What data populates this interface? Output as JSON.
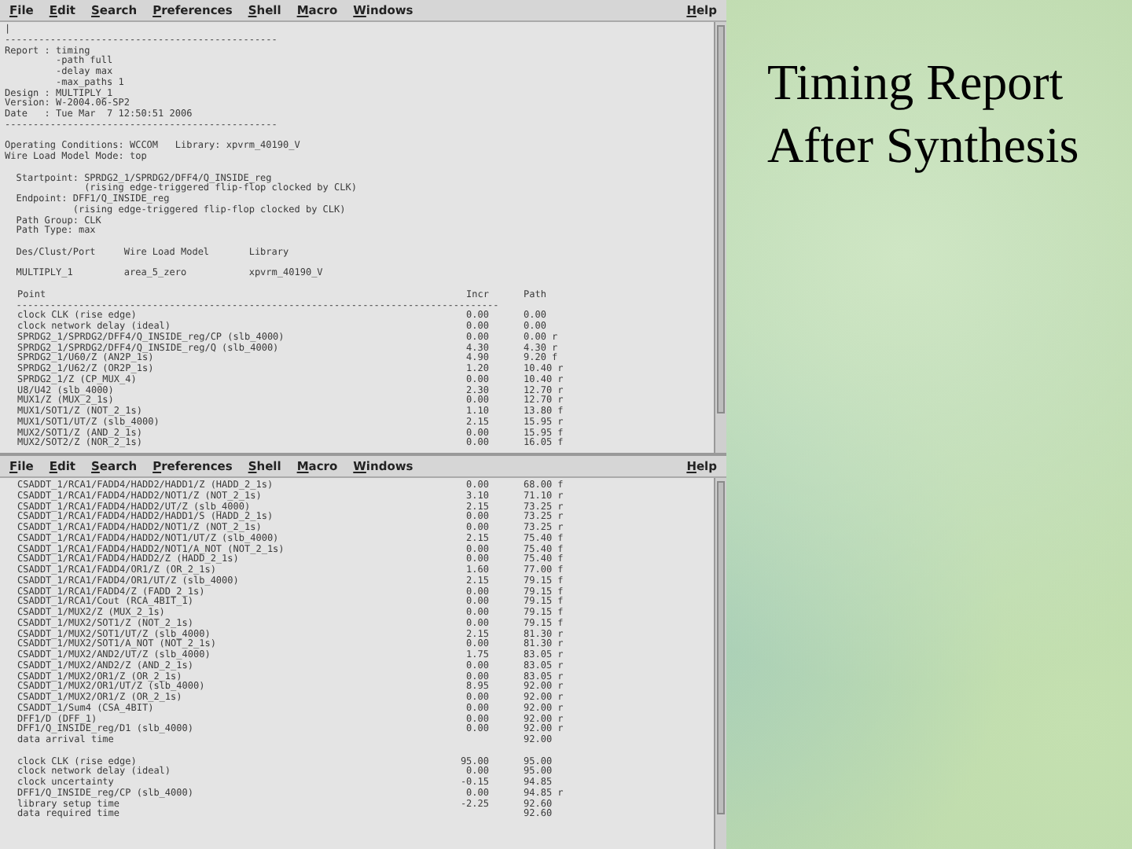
{
  "slide": {
    "title": "Timing Report After Synthesis"
  },
  "windows": [
    {
      "menu": [
        "File",
        "Edit",
        "Search",
        "Preferences",
        "Shell",
        "Macro",
        "Windows"
      ],
      "help": "Help",
      "lines": [
        {
          "kind": "text",
          "text": "|"
        },
        {
          "kind": "text",
          "text": "------------------------------------------------"
        },
        {
          "kind": "text",
          "text": "Report : timing"
        },
        {
          "kind": "text",
          "text": "         -path full"
        },
        {
          "kind": "text",
          "text": "         -delay max"
        },
        {
          "kind": "text",
          "text": "         -max_paths 1"
        },
        {
          "kind": "text",
          "text": "Design : MULTIPLY_1"
        },
        {
          "kind": "text",
          "text": "Version: W-2004.06-SP2"
        },
        {
          "kind": "text",
          "text": "Date   : Tue Mar  7 12:50:51 2006"
        },
        {
          "kind": "text",
          "text": "------------------------------------------------"
        },
        {
          "kind": "blank"
        },
        {
          "kind": "text",
          "text": "Operating Conditions: WCCOM   Library: xpvrm_40190_V"
        },
        {
          "kind": "text",
          "text": "Wire Load Model Mode: top"
        },
        {
          "kind": "blank"
        },
        {
          "kind": "text",
          "text": "  Startpoint: SPRDG2_1/SPRDG2/DFF4/Q_INSIDE_reg"
        },
        {
          "kind": "text",
          "text": "              (rising edge-triggered flip-flop clocked by CLK)"
        },
        {
          "kind": "text",
          "text": "  Endpoint: DFF1/Q_INSIDE_reg"
        },
        {
          "kind": "text",
          "text": "            (rising edge-triggered flip-flop clocked by CLK)"
        },
        {
          "kind": "text",
          "text": "  Path Group: CLK"
        },
        {
          "kind": "text",
          "text": "  Path Type: max"
        },
        {
          "kind": "blank"
        },
        {
          "kind": "text",
          "text": "  Des/Clust/Port     Wire Load Model       Library"
        },
        {
          "kind": "blank"
        },
        {
          "kind": "text",
          "text": "  MULTIPLY_1         area_5_zero           xpvrm_40190_V"
        },
        {
          "kind": "blank"
        },
        {
          "kind": "row",
          "point": "Point",
          "incr": "Incr",
          "path": "Path"
        },
        {
          "kind": "text",
          "text": "  -------------------------------------------------------------------------------------"
        },
        {
          "kind": "row",
          "point": "clock CLK (rise edge)",
          "incr": "0.00",
          "path": "0.00"
        },
        {
          "kind": "row",
          "point": "clock network delay (ideal)",
          "incr": "0.00",
          "path": "0.00"
        },
        {
          "kind": "row",
          "point": "SPRDG2_1/SPRDG2/DFF4/Q_INSIDE_reg/CP (slb_4000)",
          "incr": "0.00",
          "path": "0.00 r"
        },
        {
          "kind": "row",
          "point": "SPRDG2_1/SPRDG2/DFF4/Q_INSIDE_reg/Q (slb_4000)",
          "incr": "4.30",
          "path": "4.30 r"
        },
        {
          "kind": "row",
          "point": "SPRDG2_1/U60/Z (AN2P_1s)",
          "incr": "4.90",
          "path": "9.20 f"
        },
        {
          "kind": "row",
          "point": "SPRDG2_1/U62/Z (OR2P_1s)",
          "incr": "1.20",
          "path": "10.40 r"
        },
        {
          "kind": "row",
          "point": "SPRDG2_1/Z (CP_MUX_4)",
          "incr": "0.00",
          "path": "10.40 r"
        },
        {
          "kind": "row",
          "point": "U8/U42 (slb_4000)",
          "incr": "2.30",
          "path": "12.70 r"
        },
        {
          "kind": "row",
          "point": "MUX1/Z (MUX_2_1s)",
          "incr": "0.00",
          "path": "12.70 r"
        },
        {
          "kind": "row",
          "point": "MUX1/SOT1/Z (NOT_2_1s)",
          "incr": "1.10",
          "path": "13.80 f"
        },
        {
          "kind": "row",
          "point": "MUX1/SOT1/UT/Z (slb_4000)",
          "incr": "2.15",
          "path": "15.95 r"
        },
        {
          "kind": "row",
          "point": "MUX2/SOT1/Z (AND_2_1s)",
          "incr": "0.00",
          "path": "15.95 f"
        },
        {
          "kind": "row",
          "point": "MUX2/SOT2/Z (NOR_2_1s)",
          "incr": "0.00",
          "path": "16.05 f"
        }
      ]
    },
    {
      "menu": [
        "File",
        "Edit",
        "Search",
        "Preferences",
        "Shell",
        "Macro",
        "Windows"
      ],
      "help": "Help",
      "lines": [
        {
          "kind": "row",
          "point": "CSADDT_1/RCA1/FADD4/HADD2/HADD1/Z (HADD_2_1s)",
          "incr": "0.00",
          "path": "68.00 f"
        },
        {
          "kind": "row",
          "point": "CSADDT_1/RCA1/FADD4/HADD2/NOT1/Z (NOT_2_1s)",
          "incr": "3.10",
          "path": "71.10 r"
        },
        {
          "kind": "row",
          "point": "CSADDT_1/RCA1/FADD4/HADD2/UT/Z (slb_4000)",
          "incr": "2.15",
          "path": "73.25 r"
        },
        {
          "kind": "row",
          "point": "CSADDT_1/RCA1/FADD4/HADD2/HADD1/S (HADD_2_1s)",
          "incr": "0.00",
          "path": "73.25 r"
        },
        {
          "kind": "row",
          "point": "CSADDT_1/RCA1/FADD4/HADD2/NOT1/Z (NOT_2_1s)",
          "incr": "0.00",
          "path": "73.25 r"
        },
        {
          "kind": "row",
          "point": "CSADDT_1/RCA1/FADD4/HADD2/NOT1/UT/Z (slb_4000)",
          "incr": "2.15",
          "path": "75.40 f"
        },
        {
          "kind": "row",
          "point": "CSADDT_1/RCA1/FADD4/HADD2/NOT1/A_NOT (NOT_2_1s)",
          "incr": "0.00",
          "path": "75.40 f"
        },
        {
          "kind": "row",
          "point": "CSADDT_1/RCA1/FADD4/HADD2/Z (HADD_2_1s)",
          "incr": "0.00",
          "path": "75.40 f"
        },
        {
          "kind": "row",
          "point": "CSADDT_1/RCA1/FADD4/OR1/Z (OR_2_1s)",
          "incr": "1.60",
          "path": "77.00 f"
        },
        {
          "kind": "row",
          "point": "CSADDT_1/RCA1/FADD4/OR1/UT/Z (slb_4000)",
          "incr": "2.15",
          "path": "79.15 f"
        },
        {
          "kind": "row",
          "point": "CSADDT_1/RCA1/FADD4/Z (FADD_2_1s)",
          "incr": "0.00",
          "path": "79.15 f"
        },
        {
          "kind": "row",
          "point": "CSADDT_1/RCA1/Cout (RCA_4BIT_1)",
          "incr": "0.00",
          "path": "79.15 f"
        },
        {
          "kind": "row",
          "point": "CSADDT_1/MUX2/Z (MUX_2_1s)",
          "incr": "0.00",
          "path": "79.15 f"
        },
        {
          "kind": "row",
          "point": "CSADDT_1/MUX2/SOT1/Z (NOT_2_1s)",
          "incr": "0.00",
          "path": "79.15 f"
        },
        {
          "kind": "row",
          "point": "CSADDT_1/MUX2/SOT1/UT/Z (slb_4000)",
          "incr": "2.15",
          "path": "81.30 r"
        },
        {
          "kind": "row",
          "point": "CSADDT_1/MUX2/SOT1/A_NOT (NOT_2_1s)",
          "incr": "0.00",
          "path": "81.30 r"
        },
        {
          "kind": "row",
          "point": "CSADDT_1/MUX2/AND2/UT/Z (slb_4000)",
          "incr": "1.75",
          "path": "83.05 r"
        },
        {
          "kind": "row",
          "point": "CSADDT_1/MUX2/AND2/Z (AND_2_1s)",
          "incr": "0.00",
          "path": "83.05 r"
        },
        {
          "kind": "row",
          "point": "CSADDT_1/MUX2/OR1/Z (OR_2_1s)",
          "incr": "0.00",
          "path": "83.05 r"
        },
        {
          "kind": "row",
          "point": "CSADDT_1/MUX2/OR1/UT/Z (slb_4000)",
          "incr": "8.95",
          "path": "92.00 r"
        },
        {
          "kind": "row",
          "point": "CSADDT_1/MUX2/OR1/Z (OR_2_1s)",
          "incr": "0.00",
          "path": "92.00 r"
        },
        {
          "kind": "row",
          "point": "CSADDT_1/Sum4 (CSA_4BIT)",
          "incr": "0.00",
          "path": "92.00 r"
        },
        {
          "kind": "row",
          "point": "DFF1/D (DFF_1)",
          "incr": "0.00",
          "path": "92.00 r"
        },
        {
          "kind": "row",
          "point": "DFF1/Q_INSIDE_reg/D1 (slb_4000)",
          "incr": "0.00",
          "path": "92.00 r"
        },
        {
          "kind": "row",
          "point": "data arrival time",
          "path": "92.00"
        },
        {
          "kind": "blank"
        },
        {
          "kind": "row",
          "point": "clock CLK (rise edge)",
          "incr": "95.00",
          "path": "95.00"
        },
        {
          "kind": "row",
          "point": "clock network delay (ideal)",
          "incr": "0.00",
          "path": "95.00"
        },
        {
          "kind": "row",
          "point": "clock uncertainty",
          "incr": "-0.15",
          "path": "94.85"
        },
        {
          "kind": "row",
          "point": "DFF1/Q_INSIDE_reg/CP (slb_4000)",
          "incr": "0.00",
          "path": "94.85 r"
        },
        {
          "kind": "row",
          "point": "library setup time",
          "incr": "-2.25",
          "path": "92.60"
        },
        {
          "kind": "row",
          "point": "data required time",
          "path": "92.60"
        }
      ]
    }
  ]
}
